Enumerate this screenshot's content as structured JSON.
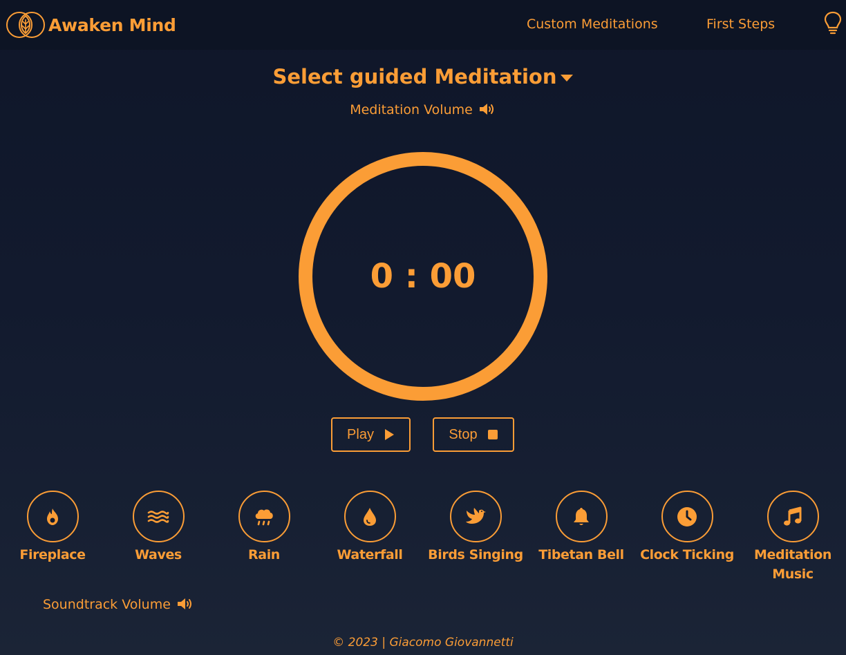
{
  "nav": {
    "brand": "Awaken Mind",
    "links": [
      "Custom Meditations",
      "First Steps"
    ],
    "help_icon": "lightbulb-icon"
  },
  "meditation": {
    "select_label": "Select guided Meditation",
    "volume_label": "Meditation Volume",
    "timer": "0 : 00"
  },
  "controls": {
    "play_label": "Play",
    "stop_label": "Stop"
  },
  "sounds": [
    {
      "label": "Fireplace",
      "icon": "fire-icon"
    },
    {
      "label": "Waves",
      "icon": "water-icon"
    },
    {
      "label": "Rain",
      "icon": "cloud-rain-icon"
    },
    {
      "label": "Waterfall",
      "icon": "droplet-icon"
    },
    {
      "label": "Birds Singing",
      "icon": "dove-icon"
    },
    {
      "label": "Tibetan Bell",
      "icon": "bell-icon"
    },
    {
      "label": "Clock Ticking",
      "icon": "clock-icon"
    },
    {
      "label": "Meditation Music",
      "icon": "music-icon"
    }
  ],
  "soundtrack_volume_label": "Soundtrack Volume",
  "footer": "© 2023 | Giacomo Giovannetti",
  "colors": {
    "accent": "#fb9d36",
    "background": "#121a2e",
    "navbar": "#0d1424"
  }
}
